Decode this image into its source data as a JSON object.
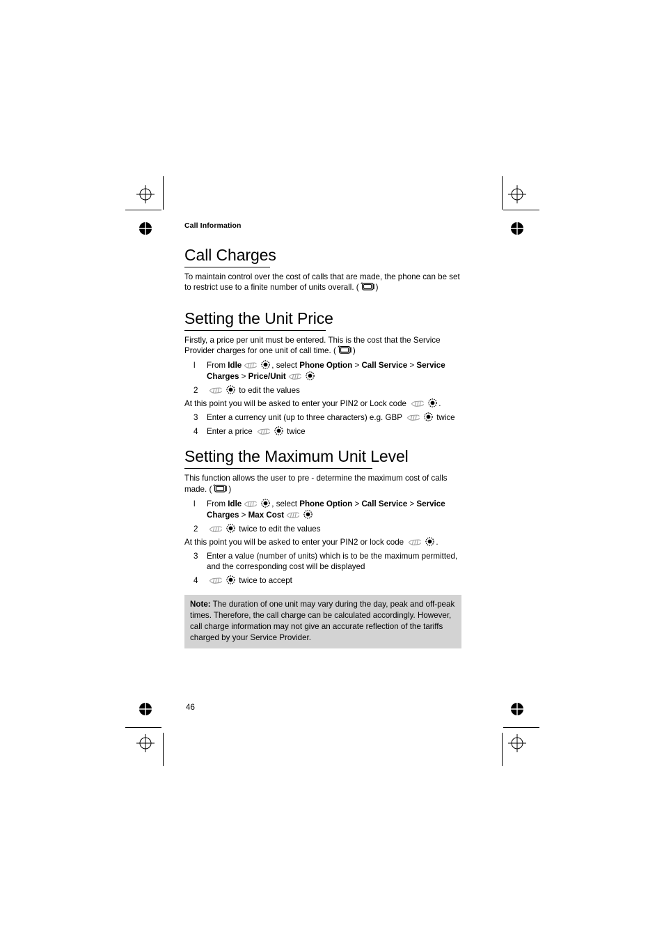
{
  "document": {
    "running_head": "Call Information",
    "page_number": "46"
  },
  "icons": {
    "scroll": "scroll-key-icon",
    "select": "select-key-icon",
    "display": "phone-display-icon"
  },
  "sections": [
    {
      "id": "call-charges",
      "heading": "Call Charges",
      "intro_before": "To maintain control over the cost of calls that are made, the phone can be set to restrict use to a finite number of units overall. (",
      "intro_after": ")"
    },
    {
      "id": "setting-the-unit-price",
      "heading": "Setting the Unit Price",
      "intro_before": "Firstly, a price per unit must be entered. This is the cost that the Service Provider charges for one unit of call time.  (",
      "intro_after": ")",
      "steps": [
        {
          "num": "l",
          "parts": [
            {
              "t": "From ",
              "b": false
            },
            {
              "t": "Idle",
              "b": true
            },
            {
              "icon": "scroll"
            },
            {
              "icon": "select"
            },
            {
              "t": ", select ",
              "b": false
            },
            {
              "t": "Phone Option",
              "b": true
            },
            {
              "t": " > ",
              "b": false
            },
            {
              "t": "Call Service",
              "b": true
            },
            {
              "t": " > ",
              "b": false
            },
            {
              "t": "Service Charges",
              "b": true
            },
            {
              "t": " > ",
              "b": false
            },
            {
              "t": "Price/Unit",
              "b": true
            },
            {
              "icon": "scroll"
            },
            {
              "icon": "select"
            }
          ]
        },
        {
          "num": "2",
          "parts": [
            {
              "icon": "scroll"
            },
            {
              "icon": "select"
            },
            {
              "t": " to edit the values",
              "b": false
            }
          ]
        }
      ],
      "interstitial": {
        "text_before": "At this point you will be asked to enter your PIN2 or Lock code ",
        "text_after": "."
      },
      "steps2": [
        {
          "num": "3",
          "parts": [
            {
              "t": "Enter a currency unit (up to three characters)  e.g. GBP ",
              "b": false
            },
            {
              "icon": "scroll"
            },
            {
              "icon": "select"
            },
            {
              "t": " twice",
              "b": false
            }
          ]
        },
        {
          "num": "4",
          "parts": [
            {
              "t": "Enter a price ",
              "b": false
            },
            {
              "icon": "scroll"
            },
            {
              "icon": "select"
            },
            {
              "t": " twice",
              "b": false
            }
          ]
        }
      ]
    },
    {
      "id": "setting-the-maximum-unit-level",
      "heading": "Setting the Maximum Unit Level",
      "intro_before": "This function allows the user to pre - determine the maximum cost of calls made. (",
      "intro_after": ")",
      "steps": [
        {
          "num": "l",
          "parts": [
            {
              "t": "From ",
              "b": false
            },
            {
              "t": "Idle",
              "b": true
            },
            {
              "icon": "scroll"
            },
            {
              "icon": "select"
            },
            {
              "t": ", select ",
              "b": false
            },
            {
              "t": "Phone Option",
              "b": true
            },
            {
              "t": " > ",
              "b": false
            },
            {
              "t": "Call Service",
              "b": true
            },
            {
              "t": " > ",
              "b": false
            },
            {
              "t": "Service Charges",
              "b": true
            },
            {
              "t": " > ",
              "b": false
            },
            {
              "t": "Max Cost",
              "b": true
            },
            {
              "icon": "scroll"
            },
            {
              "icon": "select"
            }
          ]
        },
        {
          "num": "2",
          "parts": [
            {
              "icon": "scroll"
            },
            {
              "icon": "select"
            },
            {
              "t": " twice to edit the values",
              "b": false
            }
          ]
        }
      ],
      "interstitial": {
        "text_before": "At this point you will be asked to enter your PIN2 or lock code ",
        "text_after": "."
      },
      "steps2": [
        {
          "num": "3",
          "parts": [
            {
              "t": "Enter a value (number of units) which is to be the maximum permitted, and the corresponding cost will be displayed",
              "b": false
            }
          ]
        },
        {
          "num": "4",
          "parts": [
            {
              "icon": "scroll"
            },
            {
              "icon": "select"
            },
            {
              "t": " twice to accept",
              "b": false
            }
          ]
        }
      ]
    }
  ],
  "note": {
    "label": "Note:",
    "text": " The duration of one unit may vary during the day, peak and off-peak times. Therefore, the call charge can be calculated accordingly. However, call charge information may not give an accurate reflection of the tariffs charged by your Service Provider.",
    "background": "#d3d3d3"
  }
}
